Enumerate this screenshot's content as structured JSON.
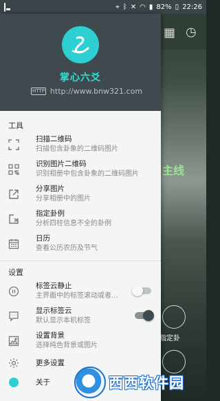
{
  "status_bar": {
    "battery": "82%",
    "time": "22:26"
  },
  "background": {
    "green_label": "主线",
    "right_button_label": "指定卦"
  },
  "header": {
    "app_name": "掌心六爻",
    "url": "http://www.bnw321.com",
    "http_badge": "HTTP"
  },
  "sections": {
    "tools_title": "工具",
    "settings_title": "设置"
  },
  "tools": [
    {
      "label": "扫描二维码",
      "sub": "扫描包含卦象的二维码图片",
      "icon": "scan-icon"
    },
    {
      "label": "识别图片二维码",
      "sub": "识别相册中包含卦象的二维码图片",
      "icon": "qr-icon"
    },
    {
      "label": "分享图片",
      "sub": "分享相册中的图片",
      "icon": "share-icon"
    },
    {
      "label": "指定卦例",
      "sub": "分析四柱信息不全的卦例",
      "icon": "edit-icon"
    },
    {
      "label": "日历",
      "sub": "查看公历农历及节气",
      "icon": "calendar-icon"
    }
  ],
  "settings": [
    {
      "label": "标签云静止",
      "sub": "主界面中的标签滚动或者...",
      "icon": "pause-icon",
      "toggle": "off"
    },
    {
      "label": "显示标签云",
      "sub": "默认显示本机标签",
      "icon": "chat-icon",
      "toggle": "on"
    },
    {
      "label": "设置背景",
      "sub": "选择纯色背景或图片",
      "icon": "image-icon"
    },
    {
      "label": "更多设置",
      "sub": "",
      "icon": "gear-icon"
    }
  ],
  "about": {
    "label": "关于"
  },
  "watermark": {
    "text": "西西软件园"
  },
  "colors": {
    "accent": "#2ecfd2",
    "header_bg": "#3e4a4e",
    "drawer_bg": "#f4f6f5"
  }
}
